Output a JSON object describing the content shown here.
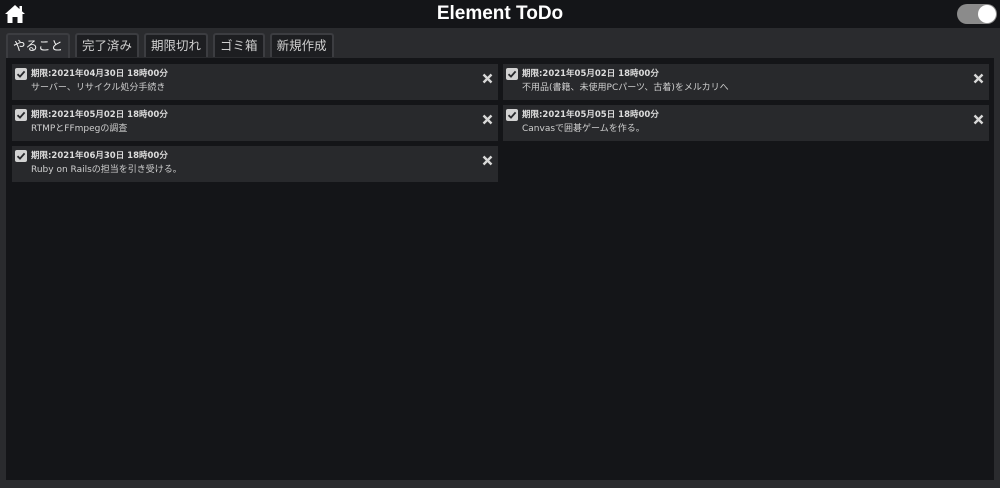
{
  "header": {
    "title": "Element ToDo",
    "home_icon": "home-icon",
    "theme_toggle": {
      "state": "on",
      "icon": "toggle-switch"
    }
  },
  "tabs": [
    {
      "label": "やること",
      "active": true
    },
    {
      "label": "完了済み",
      "active": false
    },
    {
      "label": "期限切れ",
      "active": false
    },
    {
      "label": "ゴミ箱",
      "active": false
    },
    {
      "label": "新規作成",
      "active": false
    }
  ],
  "tasks": [
    {
      "due": "期限:2021年04月30日 18時00分",
      "text": "サーバー、リサイクル処分手続き"
    },
    {
      "due": "期限:2021年05月02日 18時00分",
      "text": "不用品(書籍、未使用PCパーツ、古着)をメルカリへ"
    },
    {
      "due": "期限:2021年05月02日 18時00分",
      "text": "RTMPとFFmpegの調査"
    },
    {
      "due": "期限:2021年05月05日 18時00分",
      "text": "Canvasで囲碁ゲームを作る。"
    },
    {
      "due": "期限:2021年06月30日 18時00分",
      "text": "Ruby on Railsの担当を引き受ける。"
    }
  ],
  "colors": {
    "header_bg": "#141518",
    "frame_bg": "#2a2b2e",
    "card_bg": "#28292c",
    "text": "#e6e6e6"
  }
}
